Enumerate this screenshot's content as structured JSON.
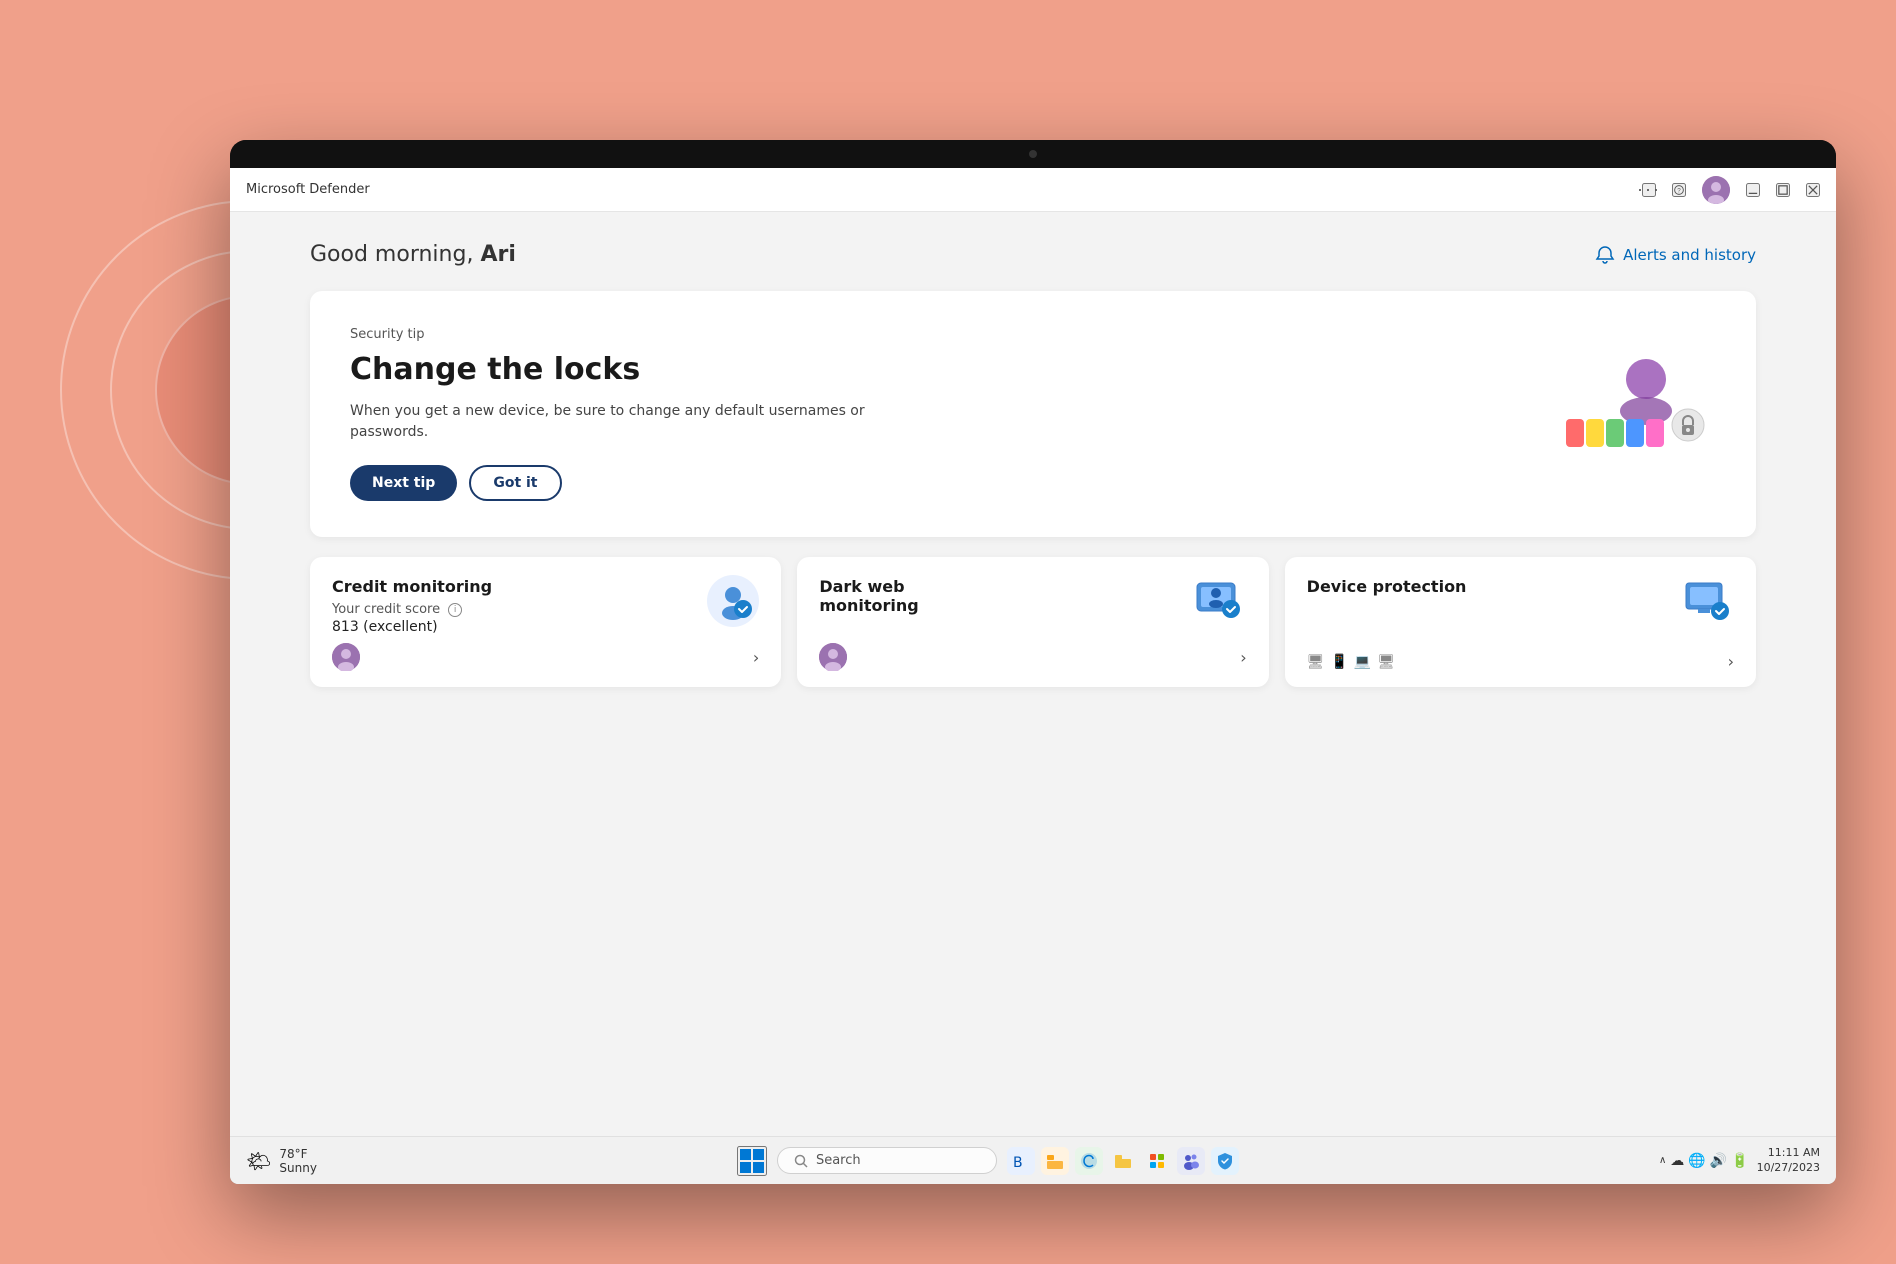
{
  "app": {
    "title": "Microsoft Defender",
    "bg_color": "#f0a08a"
  },
  "title_bar": {
    "app_name": "Microsoft Defender",
    "ellipsis": "···",
    "help": "?",
    "minimize": "—",
    "maximize": "□",
    "close": "✕"
  },
  "header": {
    "greeting": "Good morning, ",
    "username": "Ari",
    "alerts_label": "Alerts and history"
  },
  "security_tip": {
    "label": "Security tip",
    "title": "Change the locks",
    "description": "When you get a new device, be sure to change any default usernames or passwords.",
    "next_tip_label": "Next tip",
    "got_it_label": "Got it"
  },
  "cards": [
    {
      "title": "Credit monitoring",
      "subtitle": "Your credit score",
      "value": "813 (excellent)",
      "has_info": true
    },
    {
      "title": "Dark web monitoring",
      "subtitle": "",
      "value": ""
    },
    {
      "title": "Device protection",
      "subtitle": "",
      "value": ""
    }
  ],
  "taskbar": {
    "weather_temp": "78°F",
    "weather_condition": "Sunny",
    "search_placeholder": "Search",
    "time": "11:11 AM",
    "date": "10/27/2023"
  }
}
